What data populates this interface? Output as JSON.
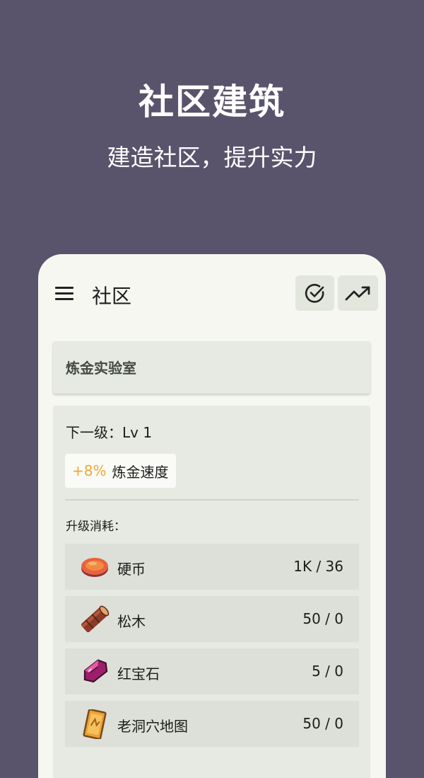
{
  "promo": {
    "title": "社区建筑",
    "subtitle": "建造社区，提升实力"
  },
  "appbar": {
    "title": "社区",
    "menu_icon": "menu-icon",
    "action_icons": [
      "check-circle-icon",
      "trending-up-icon"
    ]
  },
  "building": {
    "name": "炼金实验室"
  },
  "upgrade": {
    "next_level": "下一级：Lv 1",
    "bonus_value": "+8%",
    "bonus_label": "炼金速度",
    "cost_heading": "升级消耗：",
    "costs": [
      {
        "name": "硬币",
        "amount": "1K / 36",
        "icon": "coin-icon"
      },
      {
        "name": "松木",
        "amount": "50 / 0",
        "icon": "pine-log-icon"
      },
      {
        "name": "红宝石",
        "amount": "5 / 0",
        "icon": "ruby-icon"
      },
      {
        "name": "老洞穴地图",
        "amount": "50 / 0",
        "icon": "cave-map-icon"
      }
    ]
  },
  "colors": {
    "background": "#5a536c",
    "surface": "#f5f7f0",
    "card": "#e7eae2",
    "accent": "#f0a735"
  }
}
